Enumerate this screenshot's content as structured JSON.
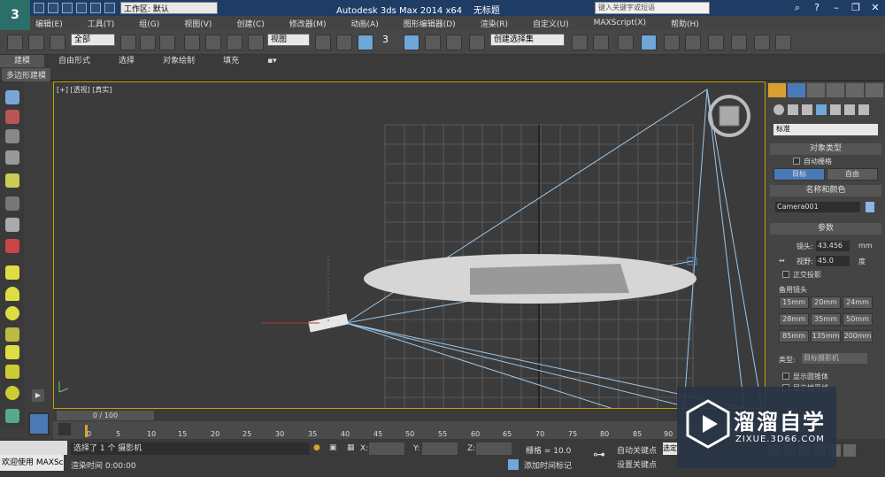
{
  "titlebar": {
    "workspace": "工作区: 默认",
    "app_title": "Autodesk 3ds Max  2014 x64",
    "doc_title": "无标题",
    "search_placeholder": "键入关键字或短语"
  },
  "menu": [
    "编辑(E)",
    "工具(T)",
    "组(G)",
    "视图(V)",
    "创建(C)",
    "修改器(M)",
    "动画(A)",
    "图形编辑器(D)",
    "渲染(R)",
    "自定义(U)",
    "MAXScript(X)",
    "帮助(H)"
  ],
  "toolbar": {
    "filter": "全部",
    "refcoord": "视图",
    "num3": "3",
    "named_sel": "创建选择集"
  },
  "ribbon": {
    "tabs": [
      "建模",
      "自由形式",
      "选择",
      "对象绘制",
      "填充"
    ],
    "sub": "多边形建模"
  },
  "viewport": {
    "label": "[+] [透视] [真实]"
  },
  "cmdpanel": {
    "category": "标准",
    "object_type": "对象类型",
    "autogrid": "自动栅格",
    "btn_target": "目标",
    "btn_free": "自由",
    "name_color": "名称和颜色",
    "name": "Camera001",
    "params": "参数",
    "lens_label": "镜头:",
    "lens_value": "43.456",
    "lens_unit": "mm",
    "fov_label": "视野:",
    "fov_value": "45.0",
    "fov_unit": "度",
    "ortho": "正交投影",
    "stock_lenses": "备用镜头",
    "lenses": [
      "15mm",
      "20mm",
      "24mm",
      "28mm",
      "35mm",
      "50mm",
      "85mm",
      "135mm",
      "200mm"
    ],
    "type_label": "类型:",
    "type_value": "目标摄影机",
    "show_cone": "显示圆锥体",
    "show_horizon": "显示地平线"
  },
  "timeline": {
    "frame": "0 / 100",
    "ticks": [
      "0",
      "5",
      "10",
      "15",
      "20",
      "25",
      "30",
      "35",
      "40",
      "45",
      "50",
      "55",
      "60",
      "65",
      "70",
      "75",
      "80",
      "85",
      "90"
    ]
  },
  "status": {
    "maxscript": "欢迎使用 MAXSc",
    "selected": "选择了 1 个 摄影机",
    "render_time": "渲染时间 0:00:00",
    "x_label": "X:",
    "y_label": "Y:",
    "z_label": "Z:",
    "grid": "栅格 = 10.0",
    "add_time_tag": "添加时间标记",
    "auto_key": "自动关键点",
    "set_key": "设置关键点",
    "selected_obj": "选定对"
  },
  "watermark": {
    "brand": "溜溜自学",
    "url": "ZIXUE.3D66.COM"
  }
}
